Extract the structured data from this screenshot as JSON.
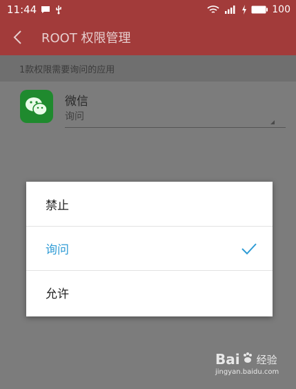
{
  "status_bar": {
    "time": "11:44",
    "battery": "100"
  },
  "toolbar": {
    "title": "ROOT 权限管理"
  },
  "section": {
    "header": "1款权限需要询问的应用"
  },
  "app": {
    "name": "微信",
    "permission": "询问"
  },
  "dialog": {
    "options": [
      {
        "label": "禁止",
        "selected": false
      },
      {
        "label": "询问",
        "selected": true
      },
      {
        "label": "允许",
        "selected": false
      }
    ]
  },
  "watermark": {
    "logo_text": "Bai",
    "logo_text2": "经验",
    "url": "jingyan.baidu.com"
  },
  "colors": {
    "toolbar": "#a23b3a",
    "accent": "#2e9bd5",
    "app_icon": "#1f8a2e"
  }
}
